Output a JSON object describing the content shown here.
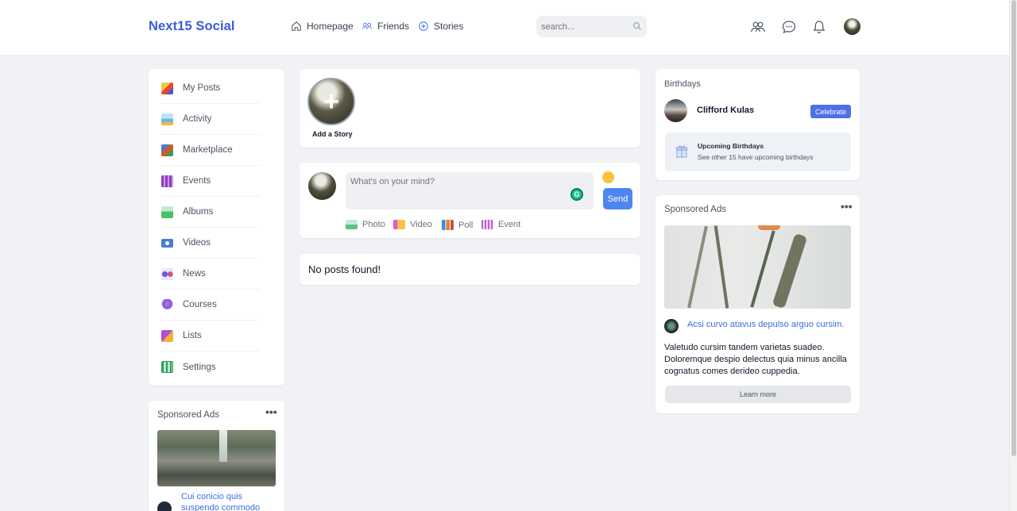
{
  "header": {
    "brand": "Next15 Social",
    "nav": [
      {
        "label": "Homepage",
        "icon": "home-icon"
      },
      {
        "label": "Friends",
        "icon": "friends-icon"
      },
      {
        "label": "Stories",
        "icon": "stories-icon"
      }
    ],
    "search_placeholder": "search...",
    "icons": [
      "people-icon",
      "messages-icon",
      "notifications-icon",
      "user-avatar"
    ]
  },
  "left_menu": {
    "items": [
      {
        "label": "My Posts",
        "icon": "posts-icon",
        "color": "#e7473c"
      },
      {
        "label": "Activity",
        "icon": "activity-icon",
        "color": "#6bb6e8"
      },
      {
        "label": "Marketplace",
        "icon": "marketplace-icon",
        "color": "#c0612f"
      },
      {
        "label": "Events",
        "icon": "events-icon",
        "color": "#8a3fbf"
      },
      {
        "label": "Albums",
        "icon": "albums-icon",
        "color": "#4cbf6a"
      },
      {
        "label": "Videos",
        "icon": "videos-icon",
        "color": "#4b7bd8"
      },
      {
        "label": "News",
        "icon": "news-icon",
        "color": "#6d5bd0"
      },
      {
        "label": "Courses",
        "icon": "courses-icon",
        "color": "#7b68e8"
      },
      {
        "label": "Lists",
        "icon": "lists-icon",
        "color": "#b34fd1"
      },
      {
        "label": "Settings",
        "icon": "settings-icon",
        "color": "#2e9e5b"
      }
    ]
  },
  "left_ads": {
    "title": "Sponsored Ads",
    "link": "Cui conicio quis suspendo commodo"
  },
  "stories": {
    "add_label": "Add a Story"
  },
  "composer": {
    "placeholder": "What's on your mind?",
    "send_label": "Send",
    "attachments": [
      {
        "label": "Photo",
        "icon": "photo-icon",
        "color": "#5ec08a"
      },
      {
        "label": "Video",
        "icon": "video-icon",
        "color": "#e255d6"
      },
      {
        "label": "Poll",
        "icon": "poll-icon",
        "color": "#e1843a"
      },
      {
        "label": "Event",
        "icon": "event-icon",
        "color": "#c25fd0"
      }
    ]
  },
  "feed": {
    "empty_text": "No posts found!"
  },
  "birthdays": {
    "title": "Birthdays",
    "person": "Clifford Kulas",
    "celebrate_label": "Celebrate",
    "upcoming_title": "Upcoming Birthdays",
    "upcoming_text": "See other 15 have upcoming birthdays"
  },
  "right_ads": {
    "title": "Sponsored Ads",
    "link": "Acsi curvo atavus depulso arguo cursim.",
    "body": "Valetudo cursim tandem varietas suadeo. Doloremque despio delectus quia minus ancilla cognatus comes derideo cuppedia.",
    "button": "Learn more"
  },
  "colors": {
    "brand": "#3a5bd9",
    "accent": "#4f85f0",
    "link": "#3b6fe0",
    "page_bg": "#f1f2f5"
  }
}
